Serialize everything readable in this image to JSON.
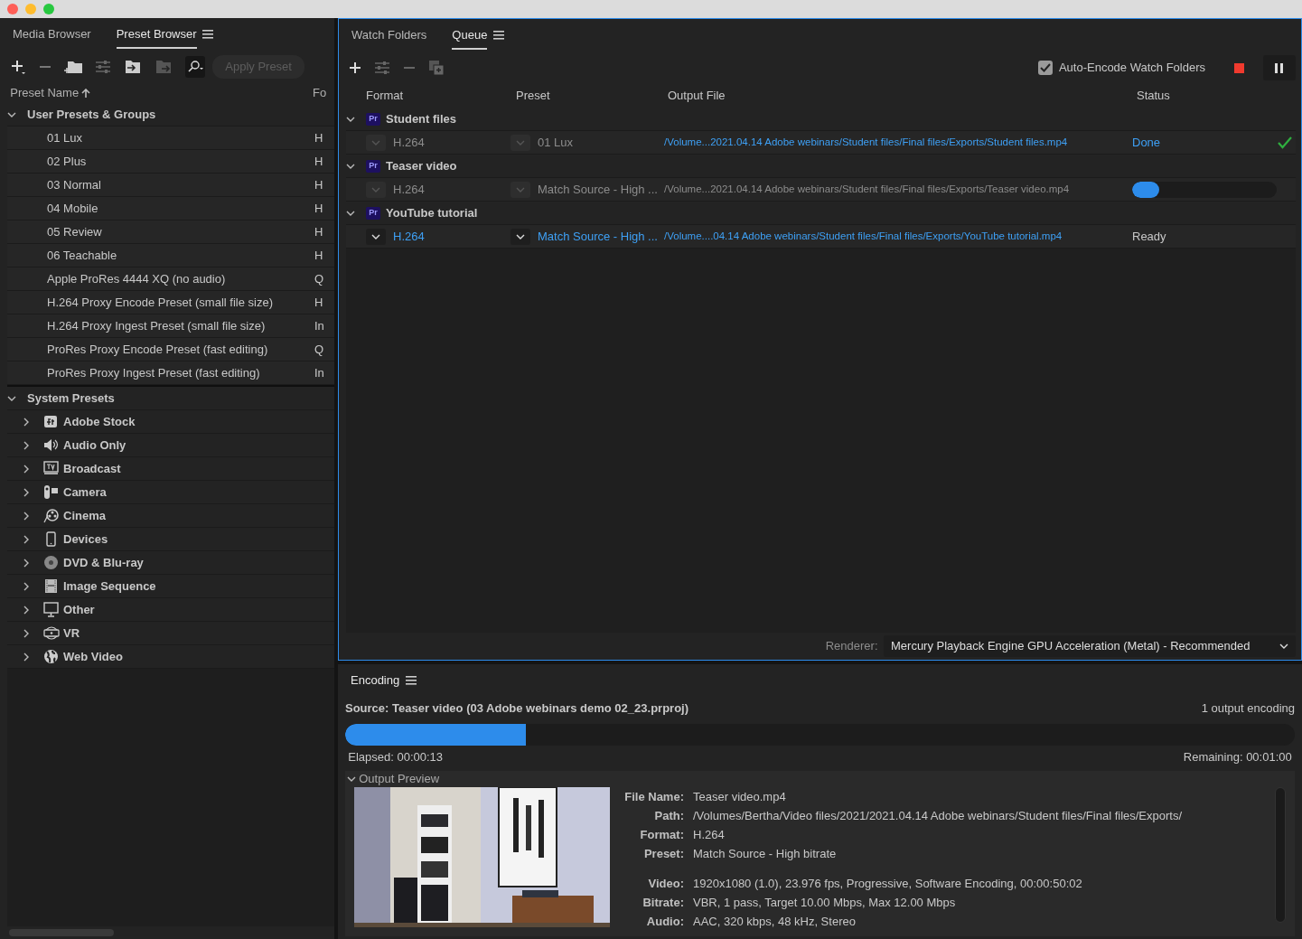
{
  "left_panel": {
    "tabs": [
      {
        "label": "Media Browser",
        "selected": false
      },
      {
        "label": "Preset Browser",
        "selected": true
      }
    ],
    "toolbar": {
      "apply_button": {
        "label": "Apply Preset",
        "disabled": true
      }
    },
    "columns": [
      "Preset Name",
      "Fo"
    ],
    "groups": [
      {
        "name": "User Presets & Groups",
        "expanded": true,
        "presets": [
          {
            "name": "01 Lux",
            "format": "H"
          },
          {
            "name": "02 Plus",
            "format": "H"
          },
          {
            "name": "03 Normal",
            "format": "H"
          },
          {
            "name": "04 Mobile",
            "format": "H"
          },
          {
            "name": "05 Review",
            "format": "H"
          },
          {
            "name": "06 Teachable",
            "format": "H"
          },
          {
            "name": "Apple ProRes 4444 XQ (no audio)",
            "format": "Q"
          },
          {
            "name": "H.264 Proxy Encode Preset (small file size)",
            "format": "H"
          },
          {
            "name": "H.264 Proxy Ingest Preset (small file size)",
            "format": "In"
          },
          {
            "name": "ProRes Proxy Encode Preset (fast editing)",
            "format": "Q"
          },
          {
            "name": "ProRes Proxy Ingest Preset (fast editing)",
            "format": "In"
          }
        ]
      },
      {
        "name": "System Presets",
        "expanded": true,
        "categories": [
          {
            "name": "Adobe Stock",
            "expanded": false
          },
          {
            "name": "Audio Only",
            "expanded": false
          },
          {
            "name": "Broadcast",
            "expanded": false
          },
          {
            "name": "Camera",
            "expanded": false
          },
          {
            "name": "Cinema",
            "expanded": false
          },
          {
            "name": "Devices",
            "expanded": false
          },
          {
            "name": "DVD & Blu-ray",
            "expanded": false
          },
          {
            "name": "Image Sequence",
            "expanded": false
          },
          {
            "name": "Other",
            "expanded": false
          },
          {
            "name": "VR",
            "expanded": false
          },
          {
            "name": "Web Video",
            "expanded": false
          }
        ]
      }
    ]
  },
  "queue_panel": {
    "tabs": [
      {
        "label": "Watch Folders",
        "selected": false
      },
      {
        "label": "Queue",
        "selected": true
      }
    ],
    "auto_encode": {
      "label": "Auto-Encode Watch Folders",
      "checked": true
    },
    "columns": [
      "Format",
      "Preset",
      "Output File",
      "Status"
    ],
    "sources": [
      {
        "badge": "Pr",
        "name": "Student files",
        "expanded": true,
        "items": [
          {
            "kind": "done",
            "format": "H.264",
            "preset": "01 Lux",
            "output": "/Volume...2021.04.14 Adobe webinars/Student files/Final files/Exports/Student files.mp4",
            "status": "Done"
          }
        ]
      },
      {
        "badge": "Pr",
        "name": "Teaser video",
        "expanded": true,
        "items": [
          {
            "kind": "encoding",
            "format": "H.264",
            "preset": "Match Source - High ...",
            "output": "/Volume...2021.04.14 Adobe webinars/Student files/Final files/Exports/Teaser video.mp4",
            "level": 0.19
          }
        ]
      },
      {
        "badge": "Pr",
        "name": "YouTube tutorial",
        "expanded": true,
        "items": [
          {
            "kind": "ready",
            "format": "H.264",
            "preset": "Match Source - High ...",
            "output": "/Volume....04.14 Adobe webinars/Student files/Final files/Exports/YouTube tutorial.mp4",
            "status": "Ready"
          }
        ]
      }
    ],
    "renderer": {
      "label": "Renderer:",
      "value": "Mercury Playback Engine GPU Acceleration (Metal) - Recommended"
    }
  },
  "encoding_panel": {
    "title": "Encoding",
    "source": "Source: Teaser video (03 Adobe webinars demo 02_23.prproj)",
    "outputs": "1 output encoding",
    "level": 0.19,
    "elapsed": "Elapsed: 00:00:13",
    "remaining": "Remaining: 00:01:00",
    "preview": {
      "label": "Output Preview",
      "expanded": true,
      "file_info": [
        {
          "key": "File Name:",
          "value": "Teaser video.mp4"
        },
        {
          "key": "Path:",
          "value": "/Volumes/Bertha/Video files/2021/2021.04.14 Adobe webinars/Student files/Final files/Exports/"
        },
        {
          "key": "Format:",
          "value": "H.264"
        },
        {
          "key": "Preset:",
          "value": "Match Source - High bitrate"
        }
      ],
      "stream_info": [
        {
          "key": "Video:",
          "value": "1920x1080 (1.0), 23.976 fps, Progressive, Software Encoding, 00:00:50:02"
        },
        {
          "key": "Bitrate:",
          "value": "VBR, 1 pass, Target 10.00 Mbps, Max 12.00 Mbps"
        },
        {
          "key": "Audio:",
          "value": "AAC, 320 kbps, 48 kHz, Stereo"
        }
      ]
    }
  }
}
